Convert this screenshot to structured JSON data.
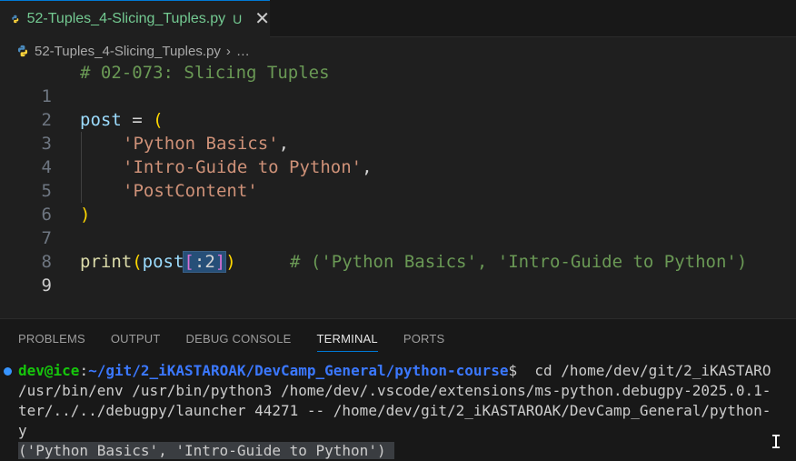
{
  "tab": {
    "filename": "52-Tuples_4-Slicing_Tuples.py",
    "status": "U",
    "close": "✕",
    "icon": "python-icon"
  },
  "breadcrumb": {
    "file": "52-Tuples_4-Slicing_Tuples.py",
    "separator": "›",
    "ellipsis": "…"
  },
  "editor": {
    "line_numbers": [
      "1",
      "2",
      "3",
      "4",
      "5",
      "6",
      "7",
      "8",
      "9"
    ],
    "lines": {
      "l1_comment": "# 02-073: Slicing Tuples",
      "l3_var": "post",
      "l3_eq": " = ",
      "l3_paren": "(",
      "l4_str": "'Python Basics'",
      "l4_comma": ",",
      "l5_str": "'Intro-Guide to Python'",
      "l5_comma": ",",
      "l6_str": "'PostContent'",
      "l7_paren": ")",
      "l9_fn": "print",
      "l9_paren_open": "(",
      "l9_var": "post",
      "l9_bracket_open": "[",
      "l9_slice": ":2",
      "l9_bracket_close": "]",
      "l9_paren_close": ")",
      "l9_comment": "# ('Python Basics', 'Intro-Guide to Python')"
    }
  },
  "panel": {
    "tabs": [
      "PROBLEMS",
      "OUTPUT",
      "DEBUG CONSOLE",
      "TERMINAL",
      "PORTS"
    ],
    "active_tab": "TERMINAL"
  },
  "terminal": {
    "user": "dev@ice",
    "colon": ":",
    "path": "~/git/2_iKASTAROAK/DevCamp_General/python-course",
    "prompt": "$",
    "command": "  cd /home/dev/git/2_iKASTARO",
    "line2": "/usr/bin/env /usr/bin/python3 /home/dev/.vscode/extensions/ms-python.debugpy-2025.0.1-",
    "line3": "ter/../../debugpy/launcher 44271 -- /home/dev/git/2_iKASTAROAK/DevCamp_General/python-",
    "line4": "y",
    "output": "('Python Basics', 'Intro-Guide to Python') "
  },
  "colors": {
    "accent": "#0078d4",
    "untracked": "#73c991",
    "editor_bg": "#1f1f1f",
    "panel_bg": "#181818"
  }
}
